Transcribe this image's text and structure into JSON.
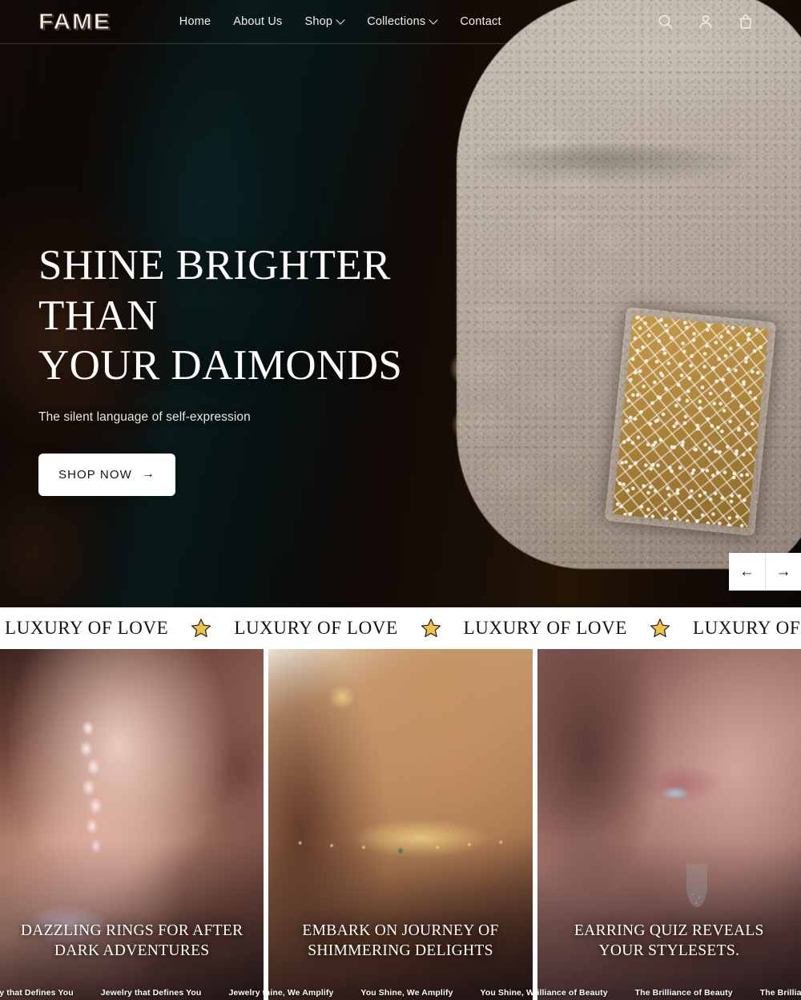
{
  "header": {
    "logo": "FAME",
    "nav": [
      {
        "label": "Home",
        "has_dropdown": false
      },
      {
        "label": "About Us",
        "has_dropdown": false
      },
      {
        "label": "Shop",
        "has_dropdown": true
      },
      {
        "label": "Collections",
        "has_dropdown": true
      },
      {
        "label": "Contact",
        "has_dropdown": false
      }
    ],
    "icons": [
      {
        "name": "search-icon",
        "label": "Search"
      },
      {
        "name": "account-icon",
        "label": "Account"
      },
      {
        "name": "cart-icon",
        "label": "Cart"
      }
    ]
  },
  "hero": {
    "title_line1": "SHINE BRIGHTER THAN",
    "title_line2": "YOUR DAIMONDS",
    "subtitle": "The silent language of self-expression",
    "cta_label": "SHOP NOW",
    "cta_arrow": "→",
    "prev_arrow": "←",
    "next_arrow": "→"
  },
  "marquee": {
    "text": "LUXURY OF LOVE",
    "separator_icon": "star-icon",
    "star_color": "#f2c244",
    "background": "#ffffff",
    "repeats": 6
  },
  "cards": [
    {
      "title": "DAZZLING RINGS FOR AFTER DARK ADVENTURES",
      "ticker": "Jewelry that Defines You"
    },
    {
      "title": "EMBARK ON JOURNEY OF SHIMMERING DELIGHTS",
      "ticker": "You Shine, We Amplify"
    },
    {
      "title": "EARRING QUIZ REVEALS YOUR STYLESETS.",
      "ticker": "The Brilliance of Beauty"
    }
  ],
  "colors": {
    "accent_gold": "#f2c244",
    "button_bg": "#ffffff",
    "button_text": "#131313",
    "text_light": "#fdfcfa"
  }
}
